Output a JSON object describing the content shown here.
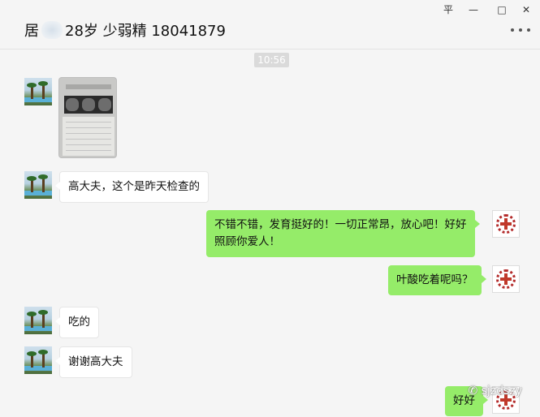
{
  "header": {
    "title_prefix": "居",
    "title_suffix": "28岁 少弱精 18041879",
    "window_buttons": {
      "pin": "平",
      "minimize": "—",
      "maximize": "□",
      "close": "✕"
    }
  },
  "timestamp": "10:56",
  "messages": [
    {
      "side": "in",
      "type": "image"
    },
    {
      "side": "in",
      "type": "text",
      "text": "高大夫，这个是昨天检查的"
    },
    {
      "side": "out",
      "type": "text",
      "lines": [
        "不错不错，发育挺好的！一切正常昂，放心吧！好好",
        "照顾你爱人！"
      ]
    },
    {
      "side": "out",
      "type": "text",
      "text": "叶酸吃着呢吗？"
    },
    {
      "side": "in",
      "type": "text",
      "text": "吃的"
    },
    {
      "side": "in",
      "type": "text",
      "text": "谢谢高大夫"
    },
    {
      "side": "out",
      "type": "text",
      "text": "好好"
    }
  ],
  "watermark": "sjzdszy",
  "colors": {
    "background": "#f5f5f5",
    "outgoing_bubble": "#95ec69",
    "incoming_bubble": "#ffffff"
  }
}
